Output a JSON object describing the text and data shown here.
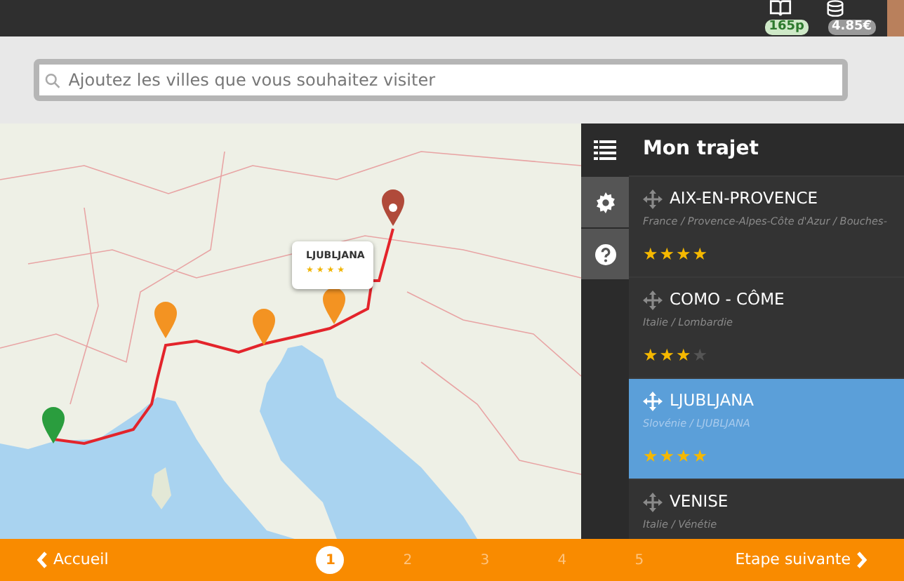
{
  "top_bar": {
    "points_badge": "165p",
    "money_badge": "4.85€"
  },
  "search": {
    "placeholder": "Ajoutez les villes que vous souhaitez visiter"
  },
  "map_popup": {
    "title": "LJUBLJANA",
    "stars": 4
  },
  "panel": {
    "title": "Mon trajet",
    "items": [
      {
        "name": "AIX-EN-PROVENCE",
        "path": "France /  Provence-Alpes-Côte d'Azur /  Bouches-",
        "stars": 4,
        "selected": false
      },
      {
        "name": "COMO - CÔME",
        "path": "Italie /  Lombardie",
        "stars": 3,
        "selected": false
      },
      {
        "name": "LJUBLJANA",
        "path": "Slovénie /  LJUBLJANA",
        "stars": 4,
        "selected": true
      },
      {
        "name": "VENISE",
        "path": "Italie /  Vénétie",
        "selected": false
      }
    ]
  },
  "footer": {
    "back": "Accueil",
    "next": "Etape suivante",
    "steps": [
      {
        "label": "1",
        "selected": true
      },
      {
        "label": "2",
        "selected": false
      },
      {
        "label": "3",
        "selected": false
      },
      {
        "label": "4",
        "selected": false
      },
      {
        "label": "5",
        "selected": false
      }
    ]
  }
}
